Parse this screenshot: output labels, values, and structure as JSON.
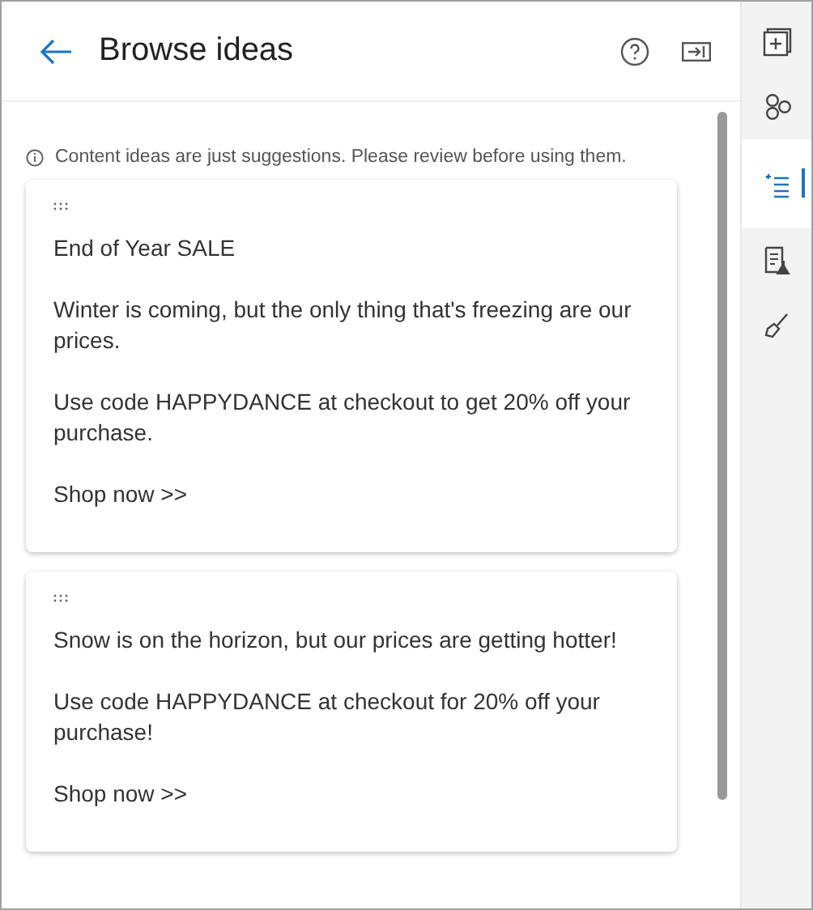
{
  "header": {
    "title": "Browse ideas"
  },
  "notice": "Content ideas are just suggestions. Please review before using them.",
  "cards": [
    {
      "paragraphs": [
        "End of Year SALE",
        "Winter is coming, but the only thing that's freezing are our prices.",
        "Use code HAPPYDANCE at checkout to get 20% off your purchase.",
        "Shop now >>"
      ]
    },
    {
      "paragraphs": [
        "Snow is on the horizon, but our prices are getting hotter!",
        "Use code HAPPYDANCE at checkout for 20% off your purchase!",
        "Shop now >>"
      ]
    }
  ],
  "rail": [
    {
      "selected": false
    },
    {
      "selected": false
    },
    {
      "selected": true
    },
    {
      "selected": false
    },
    {
      "selected": false
    }
  ]
}
